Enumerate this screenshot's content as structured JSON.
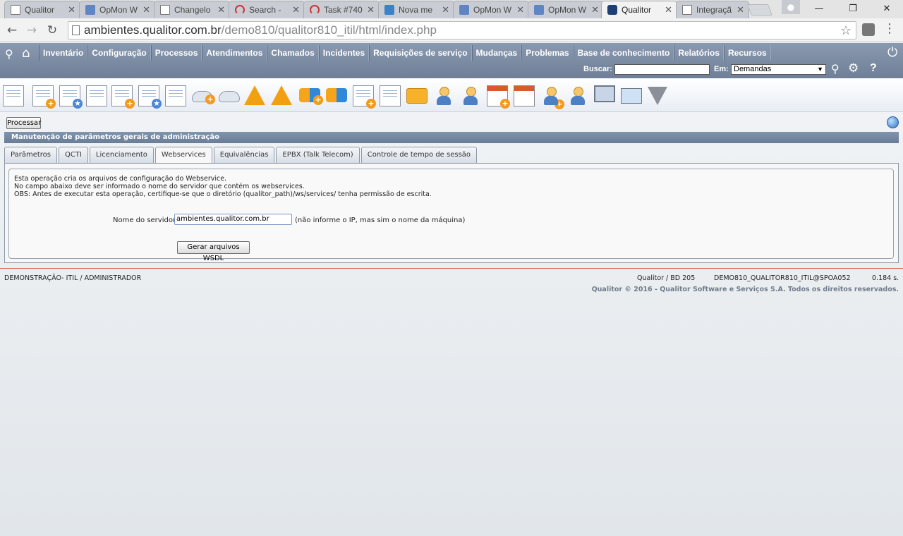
{
  "browser": {
    "tabs": [
      {
        "label": "Qualitor",
        "icon": "document-icon"
      },
      {
        "label": "OpMon W",
        "icon": "opmon-icon"
      },
      {
        "label": "Changelo",
        "icon": "document-icon"
      },
      {
        "label": "Search -",
        "icon": "redmine-icon"
      },
      {
        "label": "Task #740",
        "icon": "redmine-icon"
      },
      {
        "label": "Nova me",
        "icon": "zendesk-icon"
      },
      {
        "label": "OpMon W",
        "icon": "opmon-icon"
      },
      {
        "label": "OpMon W",
        "icon": "opmon-icon"
      },
      {
        "label": "Qualitor",
        "icon": "qualitor-icon",
        "active": true
      },
      {
        "label": "Integraçã",
        "icon": "document-icon"
      }
    ],
    "url_host": "ambientes.qualitor.com.br",
    "url_path": "/demo810/qualitor810_itil/html/index.php"
  },
  "header": {
    "menu": [
      "Inventário",
      "Configuração",
      "Processos",
      "Atendimentos",
      "Chamados",
      "Incidentes",
      "Requisições de serviço",
      "Mudanças",
      "Problemas",
      "Base de conhecimento",
      "Relatórios",
      "Recursos"
    ],
    "search_label": "Buscar:",
    "search_value": "",
    "in_label": "Em:",
    "in_value": "Demandas",
    "help": "?"
  },
  "toolbar": {
    "icons": [
      "service-documents-icon",
      "new-ticket-icon",
      "favorite-ticket-icon",
      "ticket-list-icon",
      "new-incident-icon",
      "favorite-incident-icon",
      "incident-list-icon",
      "new-request-icon",
      "request-list-icon",
      "new-problem-icon",
      "problem-list-icon",
      "new-change-icon",
      "change-list-icon",
      "new-document-icon",
      "document-list-icon",
      "open-folder-icon",
      "contact-icon",
      "contacts-list-icon",
      "new-calendar-icon",
      "calendar-icon",
      "new-group-icon",
      "group-list-icon",
      "monitor-panel-icon",
      "dashboard-chart-icon",
      "filter-funnel-icon"
    ]
  },
  "content": {
    "process_button": "Processar",
    "section_title": "Manutenção de parâmetros gerais de administração",
    "tabs": [
      "Parâmetros",
      "QCTI",
      "Licenciamento",
      "Webservices",
      "Equivalências",
      "EPBX (Talk Telecom)",
      "Controle de tempo de sessão"
    ],
    "active_tab": "Webservices",
    "info_lines": [
      "Esta operação cria os arquivos de configuração do Webservice.",
      "No campo abaixo deve ser informado o nome do servidor que contém os webservices.",
      "OBS: Antes de executar esta operação, certifique-se que o diretório (qualitor_path)/ws/services/ tenha permissão de escrita."
    ],
    "server_label": "Nome do servidor :",
    "server_value": "ambientes.qualitor.com.br",
    "server_hint": "(não informe o IP, mas sim o nome da máquina)",
    "generate_button": "Gerar arquivos WSDL"
  },
  "footer": {
    "user": "DEMONSTRAÇÃO- ITIL / ADMINISTRADOR",
    "db": "Qualitor / BD 205",
    "instance": "DEMO810_QUALITOR810_ITIL@SPOA052",
    "time": "0.184 s.",
    "copyright": "Qualitor © 2016 - Qualitor Software e Serviços S.A. Todos os direitos reservados."
  }
}
